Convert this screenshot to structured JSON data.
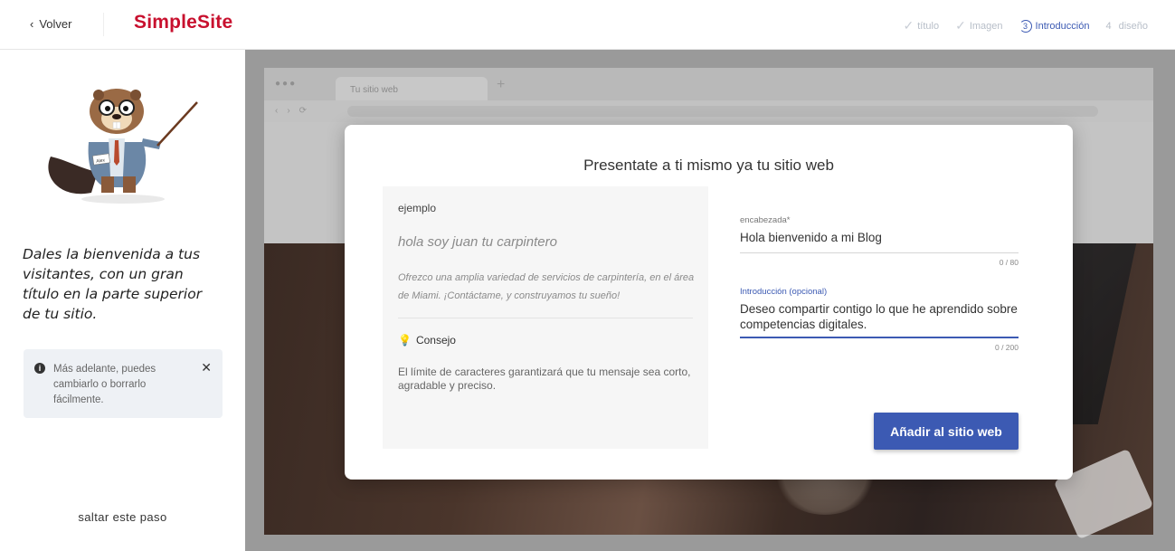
{
  "header": {
    "back_label": "Volver",
    "logo": "SimpleSite",
    "steps": [
      {
        "label": "título",
        "state": "done"
      },
      {
        "label": "Imagen",
        "state": "done"
      },
      {
        "number": "3",
        "label": "Introducción",
        "state": "active"
      },
      {
        "number": "4",
        "label": "diseño",
        "state": "upcoming"
      }
    ]
  },
  "sidebar": {
    "lead_text": "Dales la bienvenida a tus visitantes, con un gran título en la parte superior de tu sitio.",
    "notice": "Más adelante, puedes cambiarlo o borrarlo fácilmente.",
    "mascot_badge": "Alex",
    "skip_label": "saltar este paso"
  },
  "preview": {
    "tab_label": "Tu sitio web"
  },
  "modal": {
    "title": "Presentate a ti mismo ya tu sitio web",
    "example": {
      "label": "ejemplo",
      "title": "hola soy juan tu carpintero",
      "body": "Ofrezco una amplia variedad de servicios de carpintería, en el área de Miami. ¡Contáctame, y construyamos tu sueño!",
      "tip_label": "Consejo",
      "tip_text": "El límite de caracteres garantizará que tu mensaje sea corto, agradable y preciso."
    },
    "fields": [
      {
        "label": "encabezada*",
        "value": "Hola bienvenido a mi Blog",
        "counter": "0 / 80"
      },
      {
        "label": "Introducción (opcional)",
        "value": "Deseo compartir contigo lo que he aprendido sobre competencias digitales.",
        "counter": "0 / 200"
      }
    ],
    "submit_label": "Añadir al sitio web"
  },
  "colors": {
    "brand": "#c8102e",
    "accent": "#3c5ab3"
  }
}
